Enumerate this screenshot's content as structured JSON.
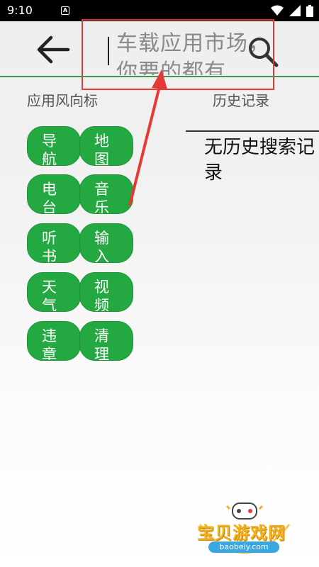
{
  "status_bar": {
    "time": "9:10",
    "app_icon_letter": "A"
  },
  "search": {
    "placeholder": "车载应用市场，你要的都有"
  },
  "sections": {
    "wind_vane": "应用风向标",
    "history": "历史记录"
  },
  "tags": [
    "导航",
    "地图",
    "电台",
    "音乐",
    "听书",
    "输入",
    "天气",
    "视频",
    "违章",
    "清理"
  ],
  "history": {
    "empty_text": "无历史搜索记录"
  },
  "watermark": {
    "text": "宝贝游戏网",
    "domain": "baobeiy.com"
  },
  "colors": {
    "accent_green": "#24a842",
    "highlight_red": "#e53935"
  }
}
